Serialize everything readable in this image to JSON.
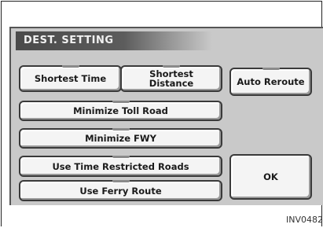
{
  "screen": {
    "title": "DEST. SETTING"
  },
  "buttons": {
    "shortest_time": "Shortest Time",
    "shortest_distance": "Shortest\nDistance",
    "auto_reroute": "Auto Reroute",
    "minimize_toll": "Minimize Toll Road",
    "minimize_fwy": "Minimize FWY",
    "time_restricted": "Use Time Restricted Roads",
    "ferry_route": "Use Ferry Route",
    "ok": "OK"
  },
  "figure_id": "INV0482"
}
